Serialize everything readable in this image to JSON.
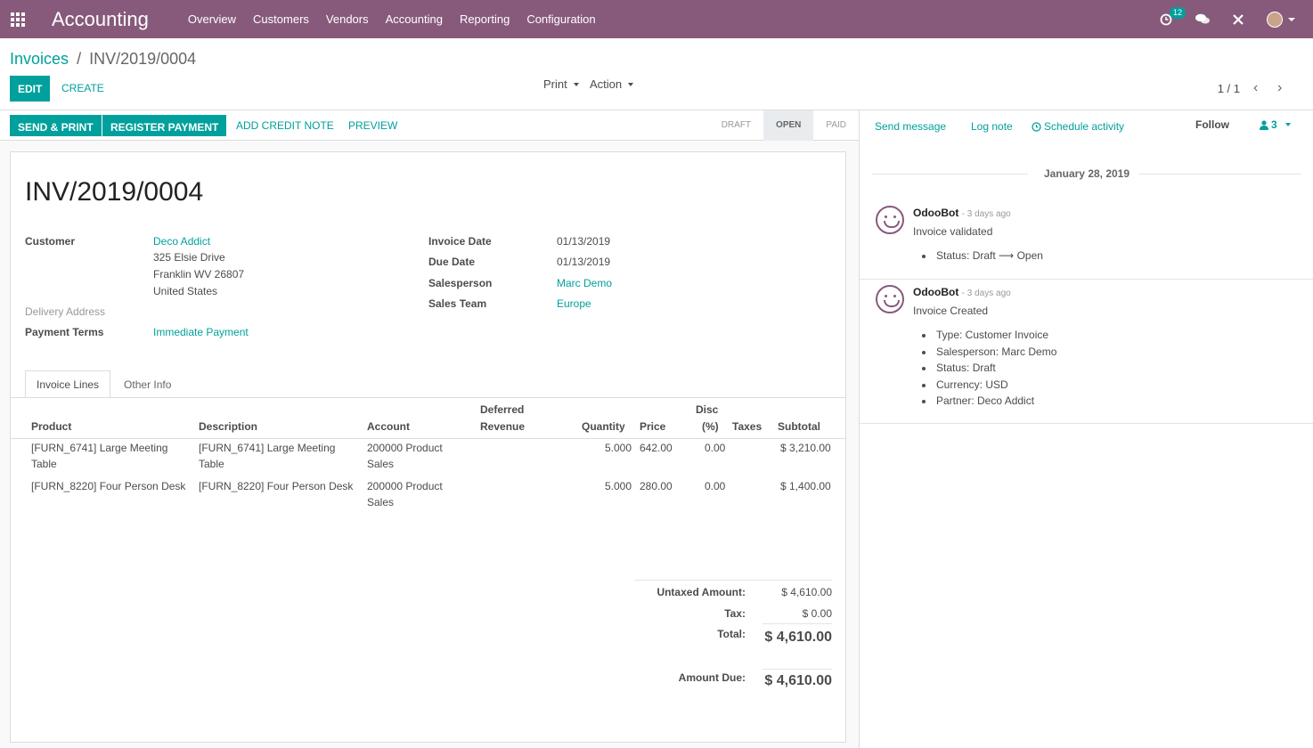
{
  "navbar": {
    "app_name": "Accounting",
    "menu": [
      "Overview",
      "Customers",
      "Vendors",
      "Accounting",
      "Reporting",
      "Configuration"
    ],
    "activity_count": "12",
    "icons": [
      "apps-grid-icon",
      "activity-clock-icon",
      "chat-icon",
      "close-icon",
      "user-avatar"
    ],
    "color": "#875a7b"
  },
  "breadcrumb": {
    "parent": "Invoices",
    "separator": "/",
    "current": "INV/2019/0004"
  },
  "control": {
    "edit": "Edit",
    "create": "Create",
    "print": "Print",
    "action": "Action",
    "pager": "1 / 1"
  },
  "statusbar": {
    "buttons": [
      "Send & Print",
      "Register Payment"
    ],
    "links": [
      "Add Credit Note",
      "Preview"
    ],
    "stages": [
      "Draft",
      "Open",
      "Paid"
    ],
    "active_stage": "Open"
  },
  "invoice": {
    "number": "INV/2019/0004",
    "customer_label": "Customer",
    "customer_name": "Deco Addict",
    "address_lines": [
      "325 Elsie Drive",
      "Franklin WV 26807",
      "United States"
    ],
    "delivery_label": "Delivery Address",
    "terms_label": "Payment Terms",
    "terms_value": "Immediate Payment",
    "invoice_date_label": "Invoice Date",
    "invoice_date": "01/13/2019",
    "due_date_label": "Due Date",
    "due_date": "01/13/2019",
    "salesperson_label": "Salesperson",
    "salesperson": "Marc Demo",
    "team_label": "Sales Team",
    "team": "Europe"
  },
  "tabs": [
    "Invoice Lines",
    "Other Info"
  ],
  "lines": {
    "headers": {
      "product": "Product",
      "description": "Description",
      "account": "Account",
      "deferred_1": "Deferred",
      "deferred_2": "Revenue",
      "quantity": "Quantity",
      "price": "Price",
      "disc_1": "Disc",
      "disc_2": "(%)",
      "taxes": "Taxes",
      "subtotal": "Subtotal"
    },
    "rows": [
      {
        "product_1": "[FURN_6741] Large Meeting",
        "product_2": "Table",
        "desc_1": "[FURN_6741] Large Meeting",
        "desc_2": "Table",
        "account_1": "200000 Product",
        "account_2": "Sales",
        "quantity": "5.000",
        "price": "642.00",
        "disc": "0.00",
        "subtotal": "$ 3,210.00"
      },
      {
        "product_1": "[FURN_8220] Four Person Desk",
        "product_2": "",
        "desc_1": "[FURN_8220] Four Person Desk",
        "desc_2": "",
        "account_1": "200000 Product",
        "account_2": "Sales",
        "quantity": "5.000",
        "price": "280.00",
        "disc": "0.00",
        "subtotal": "$ 1,400.00"
      }
    ]
  },
  "totals": {
    "untaxed_label": "Untaxed Amount:",
    "untaxed": "$ 4,610.00",
    "tax_label": "Tax:",
    "tax": "$ 0.00",
    "total_label": "Total:",
    "total": "$ 4,610.00",
    "due_label": "Amount Due:",
    "due": "$ 4,610.00"
  },
  "chatter": {
    "send_message": "Send message",
    "log_note": "Log note",
    "schedule": "Schedule activity",
    "follow": "Follow",
    "followers": "3",
    "date": "January 28, 2019",
    "messages": [
      {
        "author": "OdooBot",
        "time": "- 3 days ago",
        "body": "Invoice validated",
        "items": [
          "Status: Draft ⟶ Open"
        ]
      },
      {
        "author": "OdooBot",
        "time": "- 3 days ago",
        "body": "Invoice Created",
        "items": [
          "Type: Customer Invoice",
          "Salesperson: Marc Demo",
          "Status: Draft",
          "Currency: USD",
          "Partner: Deco Addict"
        ]
      }
    ]
  }
}
